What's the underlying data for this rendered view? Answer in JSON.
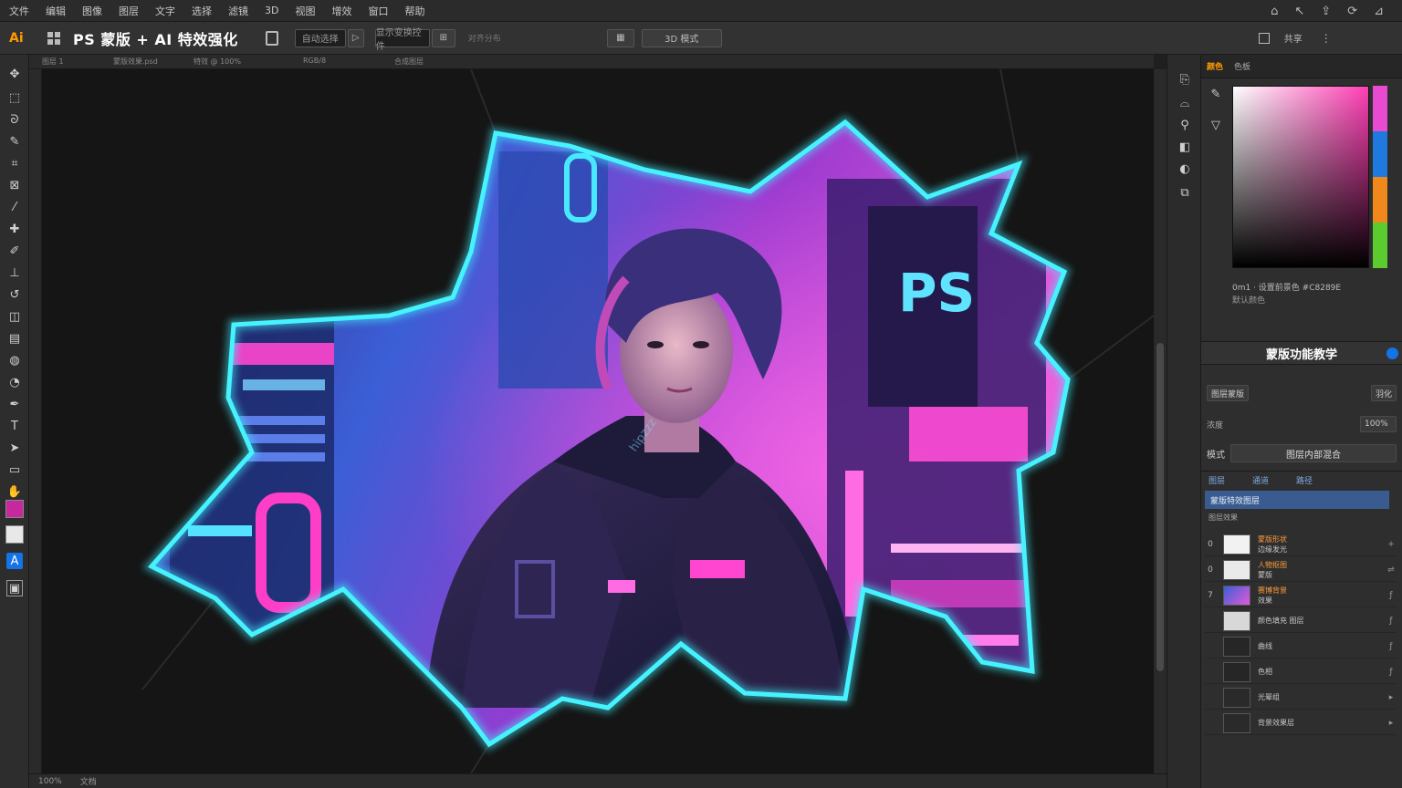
{
  "menubar": {
    "items": [
      "文件",
      "编辑",
      "图像",
      "图层",
      "文字",
      "选择",
      "滤镜",
      "3D",
      "视图",
      "增效",
      "窗口",
      "帮助"
    ],
    "right_icons": [
      "home-icon",
      "cursor-icon",
      "share-icon",
      "sync-icon",
      "arrange-icon"
    ]
  },
  "optbar": {
    "app_logo": "Ai",
    "title": "PS 蒙版 + AI 特效强化",
    "field1": "自动选择",
    "field2": "显示变换控件",
    "field3": "对齐分布",
    "btn_share": "共享",
    "mode": "3D 模式"
  },
  "canvas_tabs": [
    "图层 1",
    "蒙版效果.psd",
    "特效 @ 100%",
    "RGB/8",
    "合成图层"
  ],
  "statusbar": {
    "zoom": "100%",
    "doc": "文档"
  },
  "rpanel": {
    "tabs": [
      "颜色",
      "色板"
    ],
    "colors": {
      "hue_strip": [
        "#e84ad0",
        "#1f7ae0",
        "#f0881c",
        "#5ccb30"
      ]
    },
    "readout": "0m1 · 设置前景色 #C8289E",
    "readout2": "默认颜色",
    "section_title": "蒙版功能教学",
    "row1_label": "图层蒙版",
    "row1_value": "羽化",
    "row2_label": "浓度",
    "row2_value": "100%",
    "blend_label": "模式",
    "blend_value": "图层内部混合",
    "layers_tab1": "图层",
    "layers_tab2": "通道",
    "layers_tab3": "路径",
    "selected_layer": "蒙版特效图层",
    "sub_label": "图层效果",
    "layers": [
      {
        "eye": "0",
        "name": "蒙版形状",
        "sub": "边缘发光"
      },
      {
        "eye": "0",
        "name": "人物抠图",
        "sub": "蒙版"
      },
      {
        "eye": "7",
        "name": "赛博背景",
        "sub": "效果"
      },
      {
        "eye": "",
        "name": "颜色填充 图层",
        "sub": ""
      },
      {
        "eye": "",
        "name": "曲线",
        "sub": ""
      },
      {
        "eye": "",
        "name": "色相",
        "sub": ""
      },
      {
        "eye": "",
        "name": "光晕组",
        "sub": ""
      },
      {
        "eye": "",
        "name": "背景效果层",
        "sub": ""
      }
    ]
  },
  "artwork": {
    "sign_text": "PS",
    "watermark": "hipzzz"
  }
}
